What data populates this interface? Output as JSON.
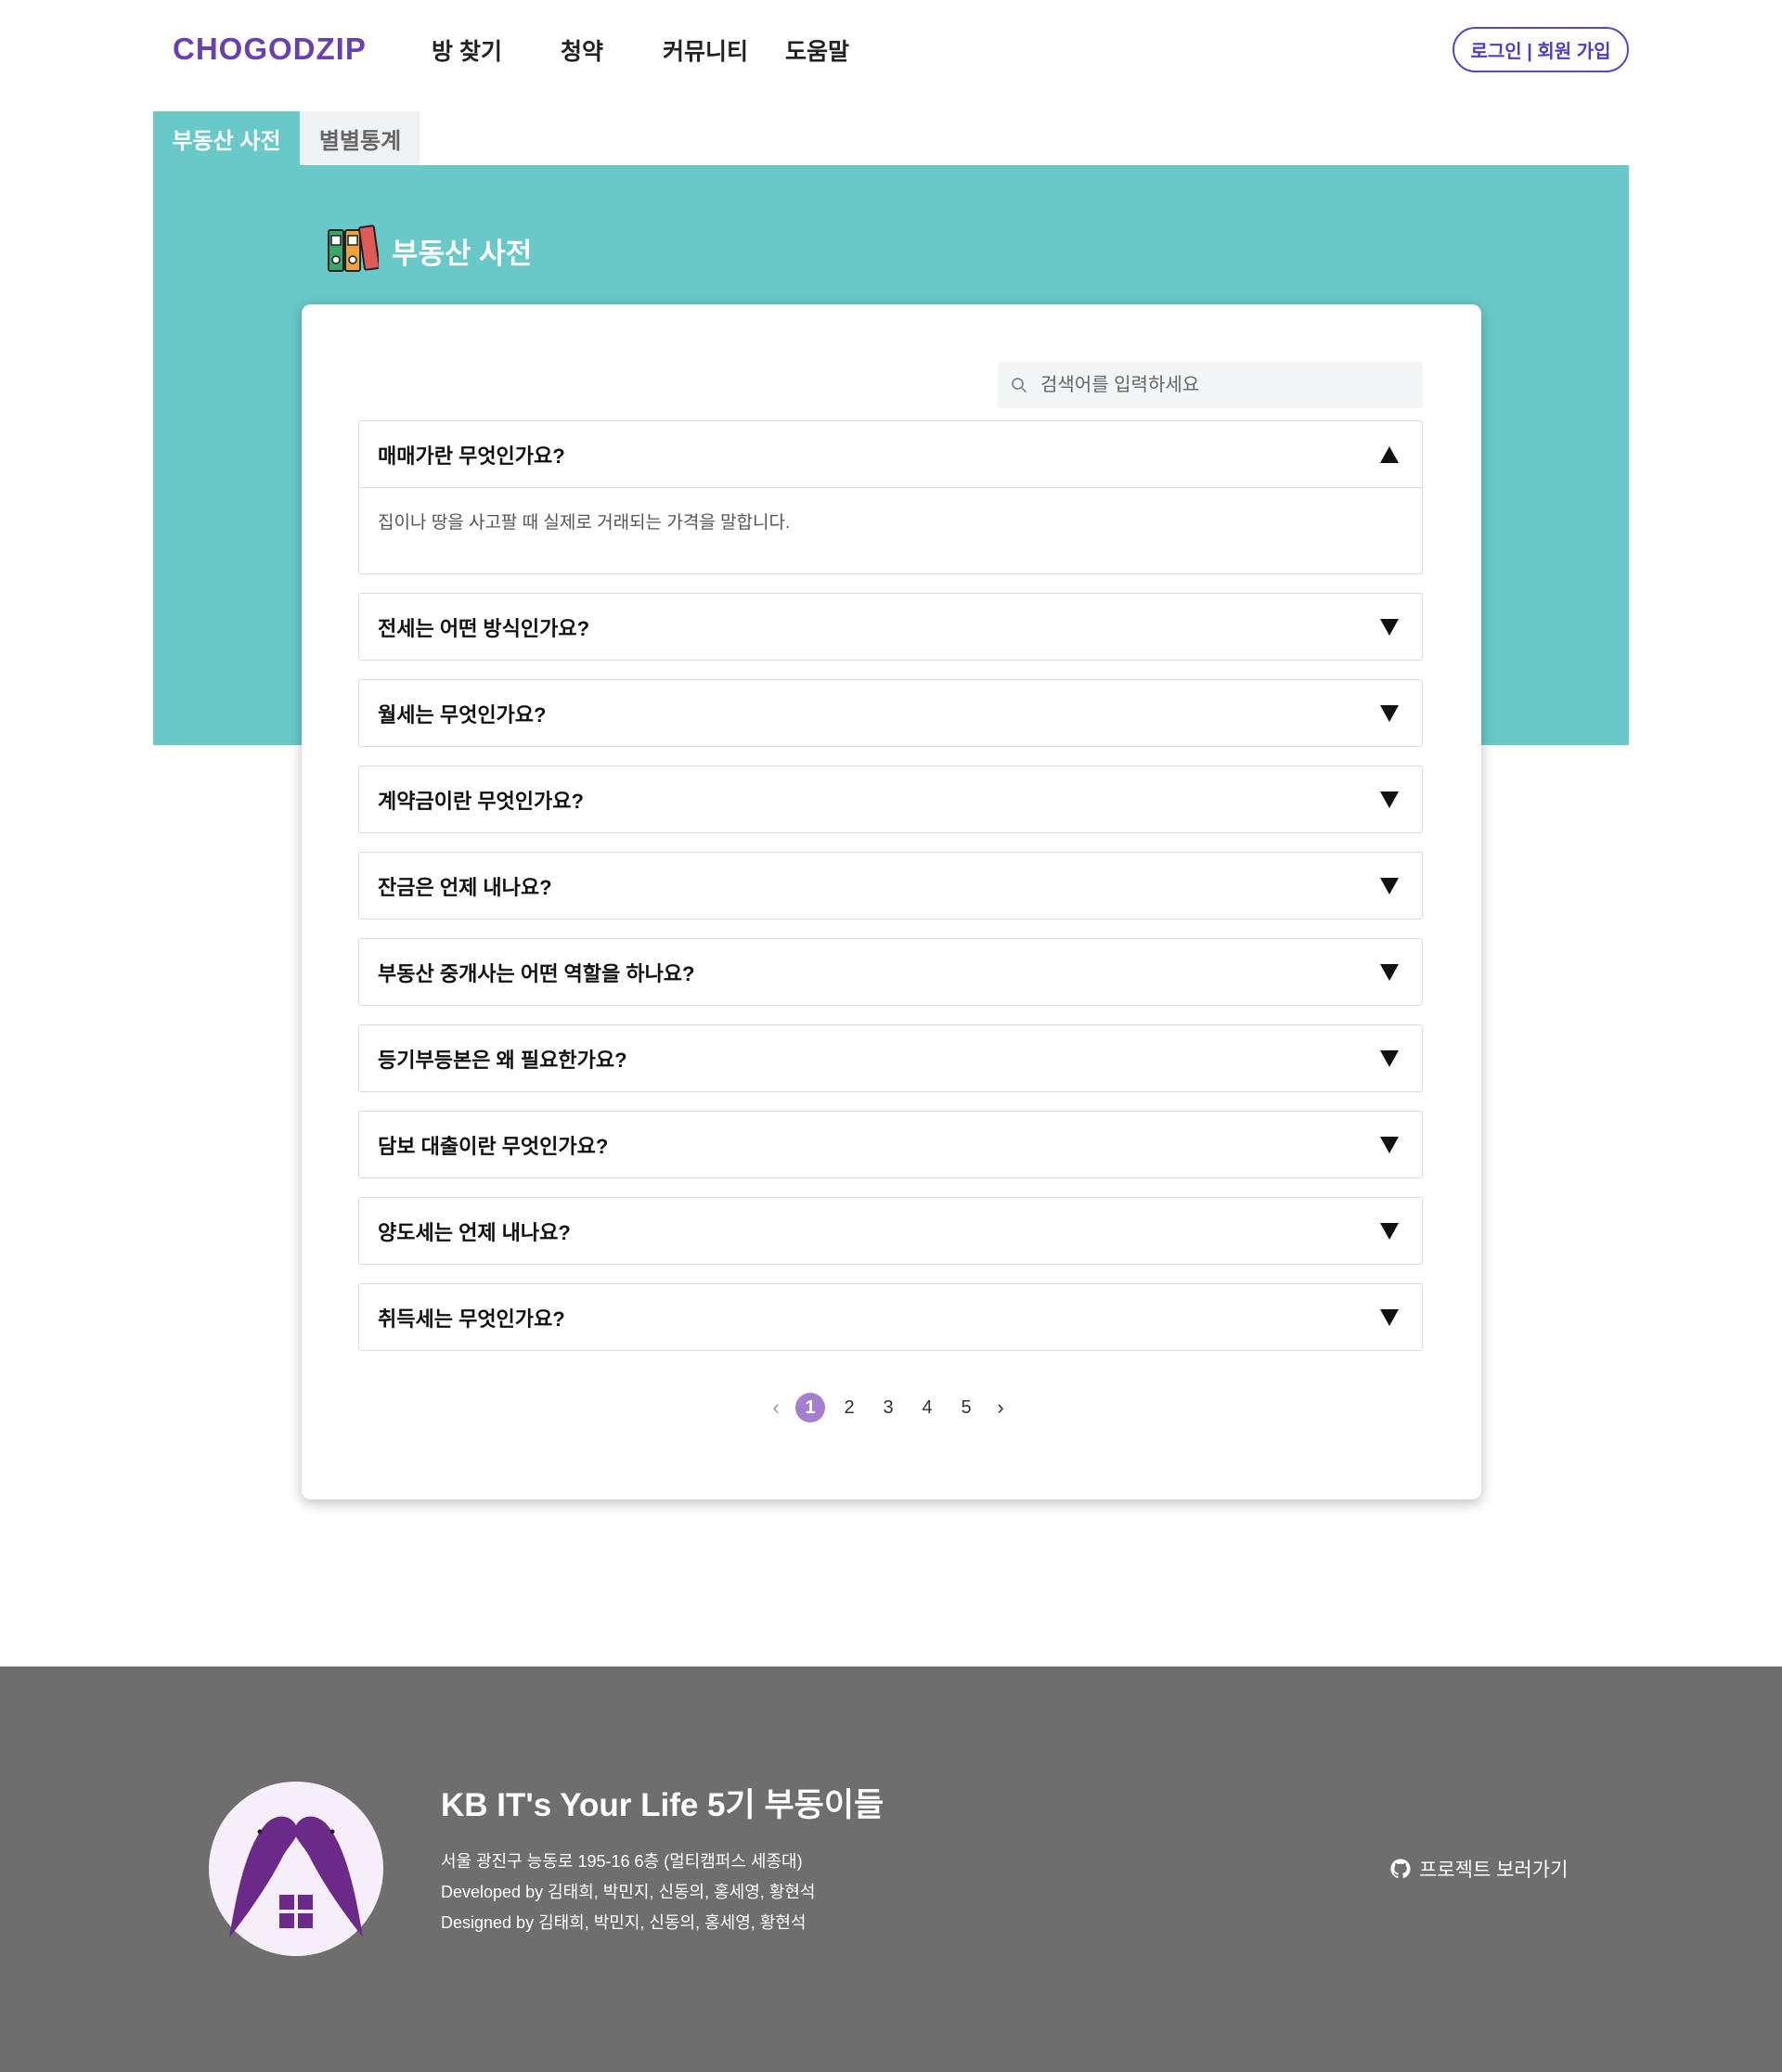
{
  "header": {
    "logo": "CHOGODZIP",
    "nav": [
      "방 찾기",
      "청약",
      "커뮤니티",
      "도움말"
    ],
    "login_label": "로그인 | 회원 가입"
  },
  "tabs": [
    {
      "label": "부동산 사전",
      "active": true
    },
    {
      "label": "별별통계",
      "active": false
    }
  ],
  "dictionary": {
    "title": "부동산 사전",
    "icon": "binders-icon"
  },
  "search": {
    "placeholder": "검색어를 입력하세요",
    "value": ""
  },
  "faq": [
    {
      "question": "매매가란 무엇인가요?",
      "answer": "집이나 땅을 사고팔 때 실제로 거래되는 가격을 말합니다.",
      "expanded": true
    },
    {
      "question": "전세는 어떤 방식인가요?",
      "expanded": false
    },
    {
      "question": "월세는 무엇인가요?",
      "expanded": false
    },
    {
      "question": "계약금이란 무엇인가요?",
      "expanded": false
    },
    {
      "question": "잔금은 언제 내나요?",
      "expanded": false
    },
    {
      "question": "부동산 중개사는 어떤 역할을 하나요?",
      "expanded": false
    },
    {
      "question": "등기부등본은 왜 필요한가요?",
      "expanded": false
    },
    {
      "question": "담보 대출이란 무엇인가요?",
      "expanded": false
    },
    {
      "question": "양도세는 언제 내나요?",
      "expanded": false
    },
    {
      "question": "취득세는 무엇인가요?",
      "expanded": false
    }
  ],
  "pagination": {
    "prev": "‹",
    "next": "›",
    "pages": [
      "1",
      "2",
      "3",
      "4",
      "5"
    ],
    "current": "1"
  },
  "footer": {
    "team": "KB IT's Your Life 5기 부동이들",
    "address": "서울 광진구 능동로 195-16 6층 (멀티캠퍼스 세종대)",
    "developed": "Developed by 김태희, 박민지, 신동의, 홍세영, 황현석",
    "designed": "Designed by 김태희, 박민지, 신동의, 홍세영, 황현석",
    "project_link": "프로젝트 보러가기"
  },
  "colors": {
    "brand_purple": "#6a3fb0",
    "teal": "#68c9c8",
    "page_active": "#a47fd0",
    "footer_bg": "#6e6e6e"
  }
}
